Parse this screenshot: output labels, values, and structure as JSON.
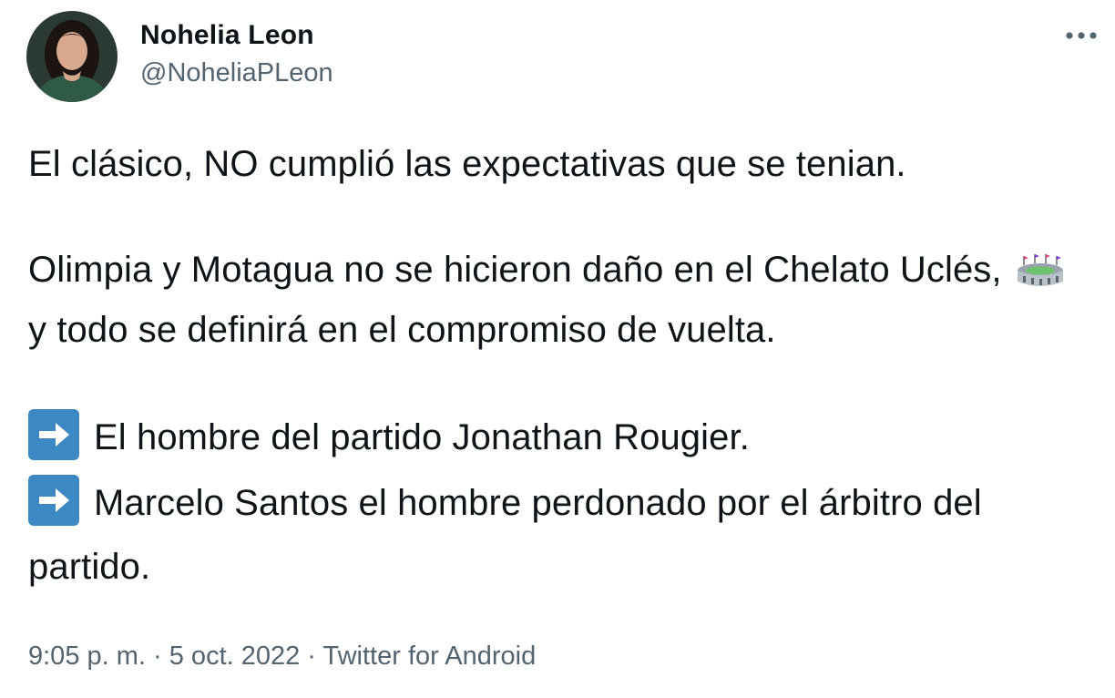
{
  "author": {
    "display_name": "Nohelia Leon",
    "handle": "@NoheliaPLeon"
  },
  "icons": {
    "more": "more-options-icon",
    "stadium": "stadium-emoji",
    "arrow": "right-arrow-emoji"
  },
  "colors": {
    "text": "#0f1419",
    "secondary": "#536471",
    "arrow_box": "#3b88c3"
  },
  "tweet": {
    "line1": "El clásico, NO cumplió las expectativas que se tenian.",
    "para2_before_emoji": "Olimpia y Motagua no se hicieron daño en el Chelato Uclés,",
    "para2_after_emoji": "y todo se definirá en el compromiso de vuelta.",
    "bullet1": "El hombre del partido Jonathan Rougier.",
    "bullet2": "Marcelo Santos el hombre perdonado por el árbitro del partido."
  },
  "meta": {
    "time": "9:05 p. m.",
    "separator": " · ",
    "date": "5 oct. 2022",
    "source": "Twitter for Android"
  }
}
